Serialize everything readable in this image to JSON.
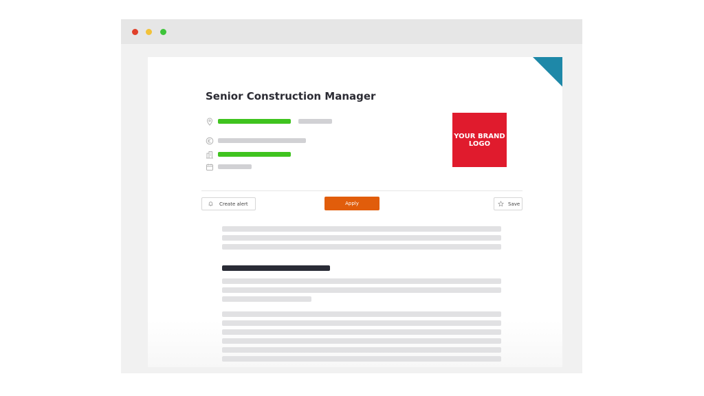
{
  "window": {
    "controls": [
      "close-dot",
      "minimize-dot",
      "maximize-dot"
    ],
    "colors": {
      "close": "#e0402a",
      "minimize": "#f2c23a",
      "maximize": "#3ec43a"
    }
  },
  "job": {
    "title": "Senior Construction Manager",
    "meta_icons": [
      "location-pin-icon",
      "currency-icon",
      "building-icon",
      "calendar-icon"
    ]
  },
  "brand_logo": {
    "line1": "YOUR BRAND",
    "line2": "LOGO",
    "color": "#e01b2d"
  },
  "actions": {
    "create_alert": "Create alert",
    "apply": "Apply",
    "save": "Save"
  },
  "colors": {
    "accent_apply": "#e15d0b",
    "highlight_bar": "#3fc31f",
    "corner_ribbon": "#1e88a8"
  }
}
